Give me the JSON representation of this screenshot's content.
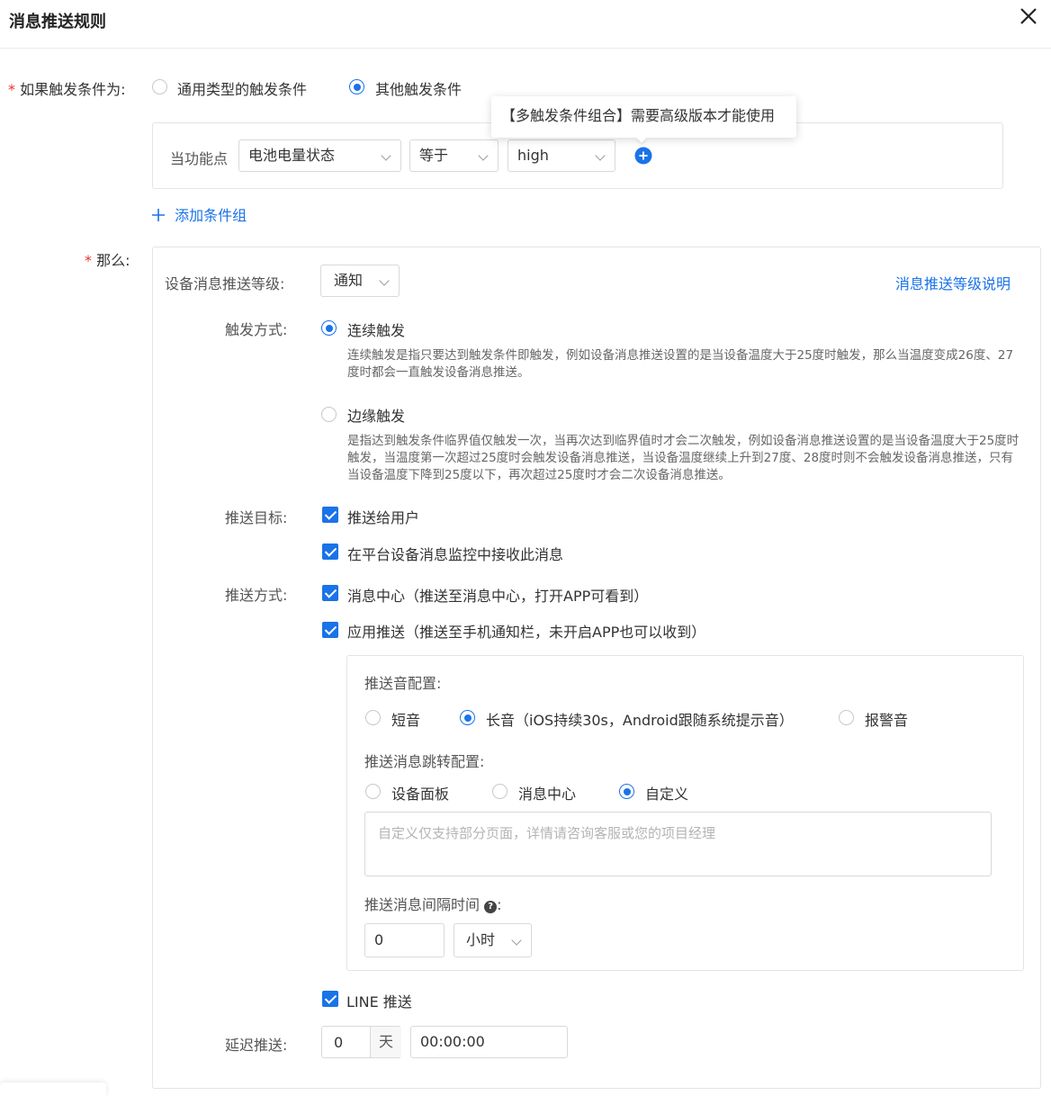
{
  "header": {
    "title": "消息推送规则"
  },
  "trigger": {
    "label": "如果触发条件为:",
    "options": [
      "通用类型的触发条件",
      "其他触发条件"
    ],
    "tooltip": "【多触发条件组合】需要高级版本才能使用",
    "condition": {
      "prefix": "当功能点",
      "field": "电池电量状态",
      "operator": "等于",
      "value": "high"
    },
    "add_group": "添加条件组"
  },
  "then": {
    "label": "那么:",
    "level_label": "设备消息推送等级:",
    "level_value": "通知",
    "level_help_link": "消息推送等级说明",
    "mode_label": "触发方式:",
    "continuous": {
      "title": "连续触发",
      "desc": "连续触发是指只要达到触发条件即触发，例如设备消息推送设置的是当设备温度大于25度时触发，那么当温度变成26度、27度时都会一直触发设备消息推送。"
    },
    "edge": {
      "title": "边缘触发",
      "desc": "是指达到触发条件临界值仅触发一次，当再次达到临界值时才会二次触发，例如设备消息推送设置的是当设备温度大于25度时触发，当温度第一次超过25度时会触发设备消息推送，当设备温度继续上升到27度、28度时则不会触发设备消息推送，只有当设备温度下降到25度以下，再次超过25度时才会二次设备消息推送。"
    },
    "target_label": "推送目标:",
    "targets": [
      "推送给用户",
      "在平台设备消息监控中接收此消息"
    ],
    "method_label": "推送方式:",
    "methods": [
      "消息中心（推送至消息中心，打开APP可看到）",
      "应用推送（推送至手机通知栏，未开启APP也可以收到）"
    ],
    "app_push": {
      "sound_label": "推送音配置:",
      "sounds": [
        "短音",
        "长音（iOS持续30s，Android跟随系统提示音）",
        "报警音"
      ],
      "jump_label": "推送消息跳转配置:",
      "jumps": [
        "设备面板",
        "消息中心",
        "自定义"
      ],
      "custom_placeholder": "自定义仅支持部分页面，详情请咨询客服或您的项目经理",
      "interval_label": "推送消息间隔时间",
      "interval_value": "0",
      "interval_unit": "小时"
    },
    "line_push": "LINE 推送",
    "delay_label": "延迟推送:",
    "delay_days": "0",
    "delay_day_unit": "天",
    "delay_time": "00:00:00"
  }
}
